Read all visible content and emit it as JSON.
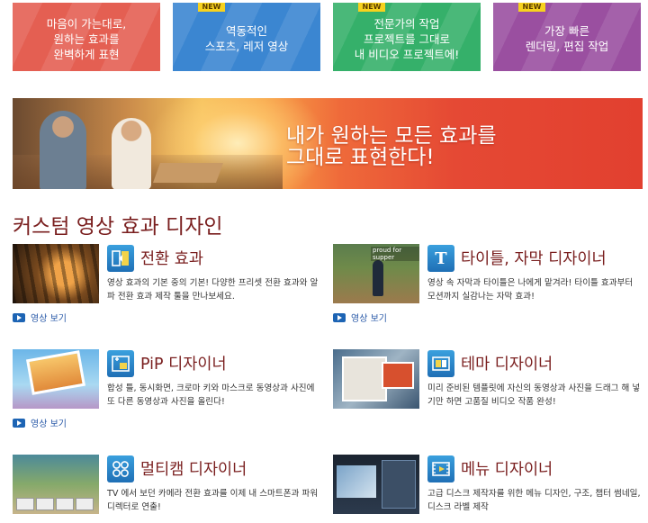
{
  "tiles": [
    {
      "text": "마음이 가는대로,\n원하는 효과를\n완벽하게 표현",
      "badge": ""
    },
    {
      "text": "역동적인\n스포츠, 레저 영상",
      "badge": "NEW"
    },
    {
      "text": "전문가의 작업\n프로젝트를 그대로\n내 비디오 프로젝트에!",
      "badge": "NEW"
    },
    {
      "text": "가장 빠른\n렌더링, 편집 작업",
      "badge": "NEW"
    }
  ],
  "banner": {
    "headline": "내가 원하는 모든 효과를\n그대로 표현한다!"
  },
  "section": {
    "title": "커스텀 영상 효과 디자인"
  },
  "features": {
    "transition": {
      "title": "전환 효과",
      "desc": "영상 효과의 기본 중의 기본! 다양한 프리셋 전환 효과와 알파 전환 효과 제작 툴을 만나보세요.",
      "watch": "영상 보기",
      "icon": "transition-icon"
    },
    "title": {
      "title": "타이틀, 자막 디자이너",
      "desc": "영상 속 자막과 타이틀은 나에게 맡겨라! 타이틀 효과부터 모션까지 실감나는 자막 효과!",
      "watch": "영상 보기",
      "icon": "title-t-icon",
      "thumb_label": "proud for supper",
      "icon_glyph": "T"
    },
    "pip": {
      "title": "PiP 디자이너",
      "desc": "합성 틀, 동시화면, 크로마 키와 마스크로 동영상과 사진에 또 다른 동영상과 사진을 올린다!",
      "watch": "영상 보기",
      "icon": "pip-icon"
    },
    "theme": {
      "title": "테마 디자이너",
      "desc": "미리 준비된 템플릿에 자신의 동영상과 사진을 드래그 해 넣기만 하면 고품질 비디오 작품 완성!",
      "icon": "theme-icon"
    },
    "multicam": {
      "title": "멀티캠 디자이너",
      "desc": "TV 에서 보던 카메라 전환 효과를 이제 내 스마트폰과 파워디렉터로 연출!",
      "icon": "multicam-icon"
    },
    "menu": {
      "title": "메뉴 디자이너",
      "desc": "고급 디스크 제작자를 위한 메뉴 디자인, 구조, 챕터 썸네일, 디스크 라벨 제작",
      "icon": "menu-film-icon"
    }
  },
  "colors": {
    "tile_red": "#e45f52",
    "tile_blue": "#3b86d1",
    "tile_green": "#35b06a",
    "tile_purple": "#9a4fa0",
    "heading": "#7a1f1f",
    "link": "#2a5aa8"
  }
}
